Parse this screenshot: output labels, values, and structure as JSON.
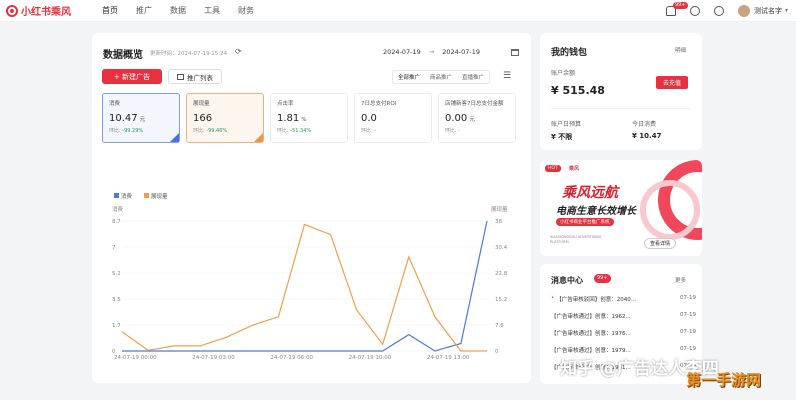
{
  "brand": {
    "name": "小红书乘风"
  },
  "nav": {
    "items": [
      "首页",
      "推广",
      "数据",
      "工具",
      "财务"
    ]
  },
  "header_right": {
    "notif_badge": "99+",
    "username": "测试名字"
  },
  "overview": {
    "title": "数据概览",
    "update_time": "更新时间：2024-07-19 15:24",
    "date_start": "2024-07-19",
    "date_end": "2024-07-19",
    "new_ad_label": "+ 新建广告",
    "ad_list_label": "推广列表",
    "segments": [
      "全部推广",
      "商品推广",
      "直播推广"
    ]
  },
  "metrics": [
    {
      "name": "消费",
      "value": "10.47",
      "unit": "元",
      "cmp_label": "环比:",
      "cmp_value": "-99.29%"
    },
    {
      "name": "展现量",
      "value": "166",
      "unit": "",
      "cmp_label": "环比:",
      "cmp_value": "-99.46%"
    },
    {
      "name": "点击率",
      "value": "1.81",
      "unit": "%",
      "cmp_label": "环比:",
      "cmp_value": "-51.34%"
    },
    {
      "name": "7日总支付ROI",
      "value": "0.0",
      "unit": "",
      "cmp_label": "环比:",
      "cmp_value": "-"
    },
    {
      "name": "店铺新客7日总支付金额",
      "value": "0.00",
      "unit": "元",
      "cmp_label": "环比:",
      "cmp_value": "-"
    }
  ],
  "chart_data": {
    "type": "line",
    "legend": [
      "消费",
      "展现量"
    ],
    "left_axis_label": "消费",
    "right_axis_label": "展现量",
    "left_ticks": [
      "0",
      "1.7",
      "3.5",
      "5.2",
      "7",
      "8.7"
    ],
    "right_ticks": [
      "0",
      "7.6",
      "15.2",
      "22.8",
      "30.4",
      "38"
    ],
    "x_ticks": [
      "24-07-19 00:00",
      "24-07-19 03:00",
      "24-07-19 06:00",
      "24-07-19 10:00",
      "24-07-19 13:00"
    ],
    "x": [
      0,
      1,
      2,
      3,
      4,
      5,
      6,
      7,
      8,
      9,
      10,
      11,
      12,
      13,
      14
    ],
    "ylim_left": [
      0,
      8.7
    ],
    "ylim_right": [
      0,
      38
    ],
    "series": [
      {
        "name": "消费",
        "color": "#4a7bd6",
        "axis": "left",
        "values": [
          0,
          0,
          0,
          0,
          0,
          0,
          0,
          0,
          0,
          0,
          0,
          1.1,
          0,
          0.5,
          8.7
        ]
      },
      {
        "name": "展现量",
        "color": "#f0a04b",
        "axis": "right",
        "values": [
          5.6,
          0.2,
          1.5,
          1.5,
          4,
          7.5,
          10,
          37,
          34,
          12,
          2,
          27.5,
          10,
          0,
          0
        ]
      }
    ]
  },
  "wallet": {
    "title": "我的钱包",
    "detail_link": "明细",
    "balance_label": "账户余额",
    "balance": "¥ 515.48",
    "recharge_label": "去充值",
    "budget_label": "账户日预算",
    "budget_value": "¥ 不限",
    "today_label": "今日消费",
    "today_value": "¥ 10.47"
  },
  "banner": {
    "tag": "HOT",
    "brand": "乘风",
    "headline": "乘风远航",
    "subline": "电商生意长效增长",
    "strip": "小红书商业平台推广系统",
    "small_en": "XIAOHONGSHU ADVERTISING PLATFORM",
    "button": "查看详情"
  },
  "messages": {
    "title": "消息中心",
    "badge": "99+",
    "more": "更多",
    "items": [
      {
        "text": "【广告审核驳回】创意：2040...",
        "date": "07-19",
        "unread": true
      },
      {
        "text": "【广告审核通过】创意：1962...",
        "date": "07-19",
        "unread": false
      },
      {
        "text": "【广告审核通过】创意：1976...",
        "date": "07-19",
        "unread": false
      },
      {
        "text": "【广告审核通过】创意：1979...",
        "date": "07-19",
        "unread": false
      },
      {
        "text": "【广告审核通过】创意：1981...",
        "date": "07-19",
        "unread": false
      }
    ]
  },
  "overlay": {
    "zhihu": "知乎 @广告达人李四",
    "corner_logo": "第一手游网"
  }
}
